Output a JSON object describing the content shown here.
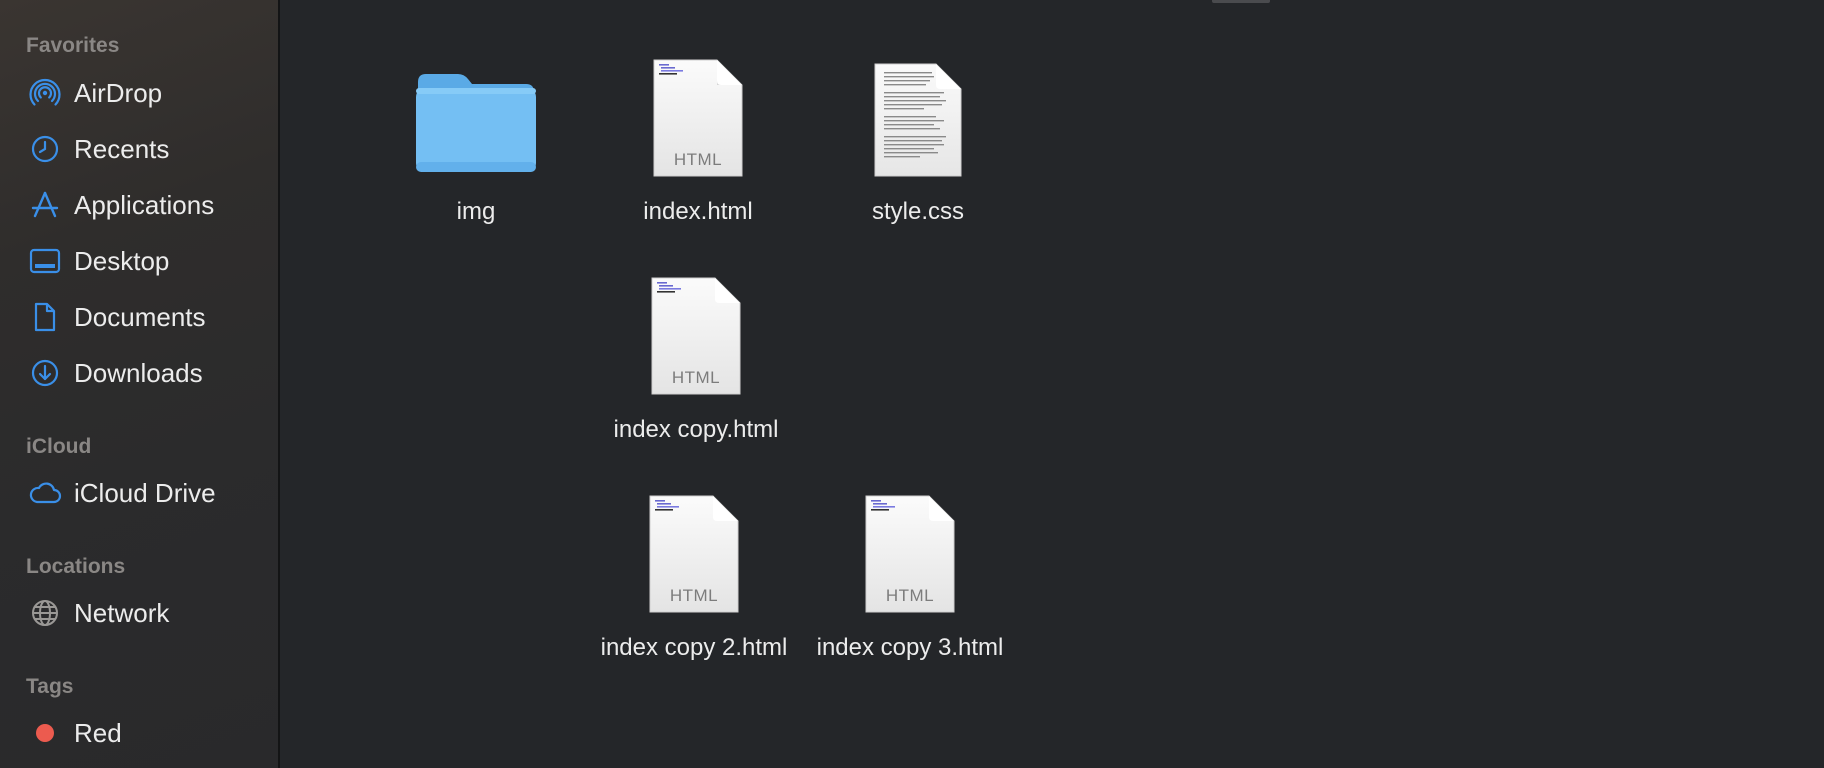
{
  "sidebar": {
    "favorites_title": "Favorites",
    "favorites": [
      {
        "label": "AirDrop",
        "icon": "airdrop-icon"
      },
      {
        "label": "Recents",
        "icon": "clock-icon"
      },
      {
        "label": "Applications",
        "icon": "applications-icon"
      },
      {
        "label": "Desktop",
        "icon": "desktop-icon"
      },
      {
        "label": "Documents",
        "icon": "document-icon"
      },
      {
        "label": "Downloads",
        "icon": "download-icon"
      }
    ],
    "icloud_title": "iCloud",
    "icloud": [
      {
        "label": "iCloud Drive",
        "icon": "cloud-icon"
      }
    ],
    "locations_title": "Locations",
    "locations": [
      {
        "label": "Network",
        "icon": "globe-icon"
      }
    ],
    "tags_title": "Tags",
    "tags": [
      {
        "label": "Red",
        "color": "#ec5b4f"
      }
    ]
  },
  "colors": {
    "accent": "#3a8fe8",
    "folder": "#74bff3",
    "tag_red": "#ec5b4f"
  },
  "files": [
    {
      "name": "img",
      "kind": "folder",
      "icon": "folder-icon"
    },
    {
      "name": "index.html",
      "kind": "html",
      "type_label": "HTML",
      "icon": "html-file-icon"
    },
    {
      "name": "style.css",
      "kind": "text",
      "icon": "css-file-icon"
    },
    {
      "name": "index copy.html",
      "kind": "html",
      "type_label": "HTML",
      "icon": "html-file-icon"
    },
    {
      "name": "index copy 2.html",
      "kind": "html",
      "type_label": "HTML",
      "icon": "html-file-icon"
    },
    {
      "name": "index copy 3.html",
      "kind": "html",
      "type_label": "HTML",
      "icon": "html-file-icon"
    }
  ]
}
